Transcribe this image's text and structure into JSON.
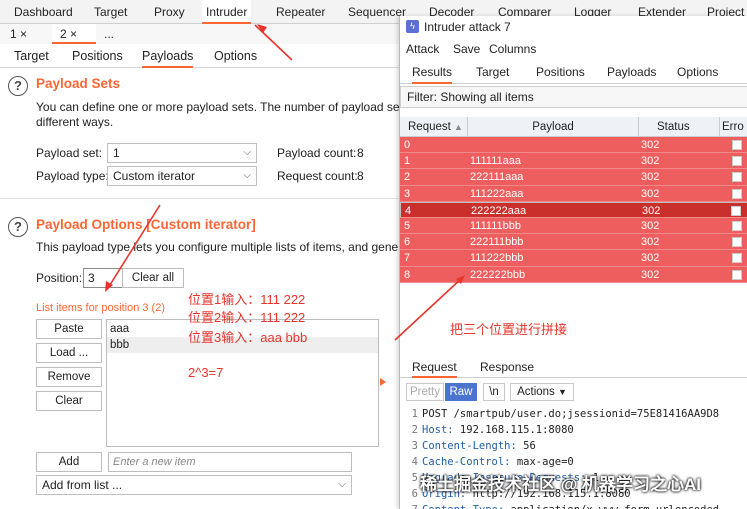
{
  "top_tabs": [
    "Dashboard",
    "Target",
    "Proxy",
    "Intruder",
    "Repeater",
    "Sequencer",
    "Decoder",
    "Comparer",
    "Logger",
    "Extender",
    "Project"
  ],
  "sub_tabs": [
    "1 ×",
    "2 ×",
    "..."
  ],
  "intruder_tabs": [
    "Target",
    "Positions",
    "Payloads",
    "Options"
  ],
  "payload_sets": {
    "title": "Payload Sets",
    "desc_line1": "You can define one or more payload sets. The number of payload sets dep",
    "desc_line2": "different ways.",
    "set_label": "Payload set:",
    "set_value": "1",
    "type_label": "Payload type:",
    "type_value": "Custom iterator",
    "count_label": "Payload count:",
    "count_value": "8",
    "request_label": "Request count:",
    "request_value": "8"
  },
  "payload_options": {
    "title": "Payload Options [Custom iterator]",
    "desc": "This payload type lets you configure multiple lists of items, and generate p",
    "position_label": "Position:",
    "position_value": "3",
    "clear_all": "Clear all",
    "list_label": "List items for position 3 (2)",
    "buttons": [
      "Paste",
      "Load ...",
      "Remove",
      "Clear"
    ],
    "items": [
      "aaa",
      "bbb"
    ],
    "add_button": "Add",
    "add_placeholder": "Enter a new item",
    "add_from_list": "Add from list ..."
  },
  "annotations": {
    "pos1": "位置1输入：111 222",
    "pos2": "位置2输入：111 222",
    "pos3": "位置3输入：aaa bbb",
    "formula": "2^3=7",
    "concat": "把三个位置进行拼接"
  },
  "attack": {
    "title": "Intruder attack 7",
    "menu": [
      "Attack",
      "Save",
      "Columns"
    ],
    "tabs": [
      "Results",
      "Target",
      "Positions",
      "Payloads",
      "Options"
    ],
    "filter": "Filter: Showing all items",
    "columns": [
      "Request",
      "Payload",
      "Status",
      "Erro"
    ],
    "rows": [
      {
        "req": "0",
        "payload": "",
        "status": "302"
      },
      {
        "req": "1",
        "payload": "111111aaa",
        "status": "302"
      },
      {
        "req": "2",
        "payload": "222111aaa",
        "status": "302"
      },
      {
        "req": "3",
        "payload": "111222aaa",
        "status": "302"
      },
      {
        "req": "4",
        "payload": "222222aaa",
        "status": "302"
      },
      {
        "req": "5",
        "payload": "111111bbb",
        "status": "302"
      },
      {
        "req": "6",
        "payload": "222111bbb",
        "status": "302"
      },
      {
        "req": "7",
        "payload": "111222bbb",
        "status": "302"
      },
      {
        "req": "8",
        "payload": "222222bbb",
        "status": "302"
      }
    ],
    "rr_tabs": [
      "Request",
      "Response"
    ],
    "toolbar": [
      "Pretty",
      "Raw",
      "\\n",
      "Actions"
    ],
    "code": [
      {
        "n": "1",
        "k": "",
        "v": "POST /smartpub/user.do;jsessionid=75E81416AA9D8"
      },
      {
        "n": "2",
        "k": "Host:",
        "v": " 192.168.115.1:8080"
      },
      {
        "n": "3",
        "k": "Content-Length:",
        "v": " 56"
      },
      {
        "n": "4",
        "k": "Cache-Control:",
        "v": " max-age=0"
      },
      {
        "n": "5",
        "k": "Upgrade-Insecure-Requests:",
        "v": " 1"
      },
      {
        "n": "6",
        "k": "Origin:",
        "v": " http://192.168.115.1:8080"
      },
      {
        "n": "7",
        "k": "Content-Type:",
        "v": " application/x-www-form-urlencoded"
      }
    ]
  },
  "watermark": "稀土掘金技术社区 @ 机器学习之心AI"
}
